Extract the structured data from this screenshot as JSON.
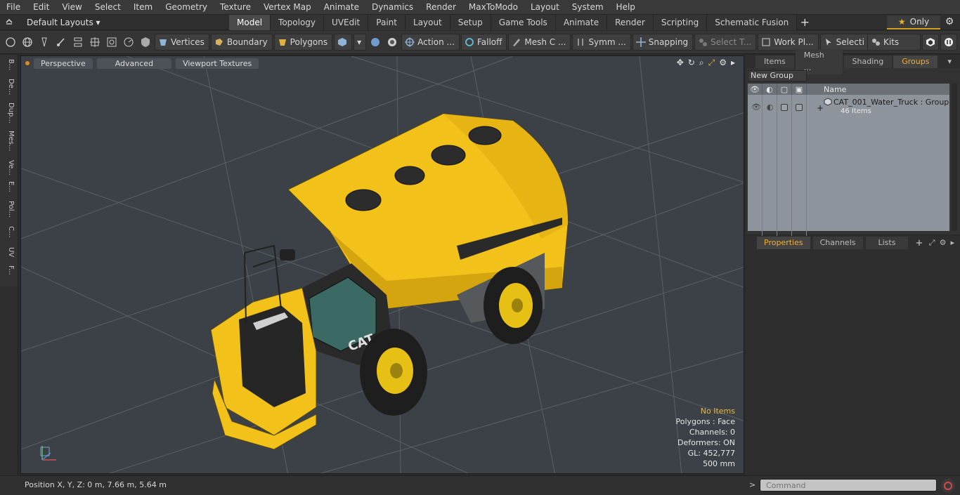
{
  "menu": [
    "File",
    "Edit",
    "View",
    "Select",
    "Item",
    "Geometry",
    "Texture",
    "Vertex Map",
    "Animate",
    "Dynamics",
    "Render",
    "MaxToModo",
    "Layout",
    "System",
    "Help"
  ],
  "layout": {
    "selector": "Default Layouts",
    "tabs": [
      "Model",
      "Topology",
      "UVEdit",
      "Paint",
      "Layout",
      "Setup",
      "Game Tools",
      "Animate",
      "Render",
      "Scripting",
      "Schematic Fusion"
    ],
    "active_tab": "Model",
    "add_tab": "+",
    "only_label": "Only"
  },
  "toolbar": {
    "vertices": "Vertices",
    "boundary": "Boundary",
    "polygons": "Polygons",
    "action": "Action ...",
    "falloff": "Falloff",
    "mesh": "Mesh C ...",
    "symm": "Symm ...",
    "snapping": "Snapping",
    "select_t": "Select T...",
    "work_pl": "Work Pl...",
    "selecti": "Selecti ...",
    "kits": "Kits"
  },
  "left_tabs": [
    "B...",
    "De...",
    "Dup...",
    "Mes...",
    "Ve...",
    "E...",
    "Pol...",
    "C...",
    "UV",
    "F..."
  ],
  "viewport": {
    "perspective": "Perspective",
    "advanced": "Advanced",
    "textures": "Viewport Textures",
    "info": {
      "selection": "No Items",
      "polygons": "Polygons : Face",
      "channels": "Channels: 0",
      "deformers": "Deformers: ON",
      "gl": "GL: 452,777",
      "scale": "500 mm"
    },
    "brand_text": "CAT",
    "colors": {
      "truck_yellow": "#f2c21b",
      "viewport_bg": "#3b4146",
      "grid": "#5b6166"
    }
  },
  "items_panel": {
    "tabs": [
      "Items",
      "Mesh ...",
      "Shading",
      "Groups"
    ],
    "active_tab": "Groups",
    "new_group": "New Group",
    "column_name": "Name",
    "group_name": "CAT_001_Water_Truck : Group",
    "group_count": "46 Items",
    "expand": "+"
  },
  "properties_panel": {
    "tabs": [
      "Properties",
      "Channels",
      "Lists"
    ],
    "active_tab": "Properties",
    "add_tab": "+"
  },
  "status": {
    "position": "Position X, Y, Z:   0 m, 7.66 m, 5.64 m",
    "command_placeholder": "Command",
    "prompt": ">"
  }
}
